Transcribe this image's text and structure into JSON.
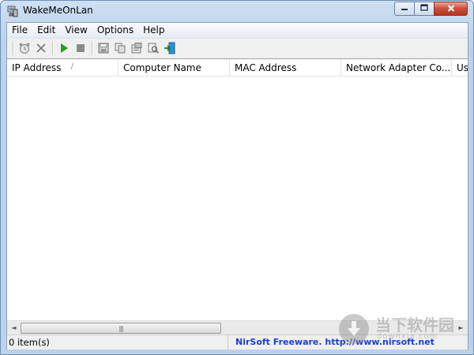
{
  "window": {
    "title": "WakeMeOnLan",
    "app_icon": "network-computer-icon",
    "caption_buttons": {
      "minimize": "minimize-icon",
      "maximize": "maximize-icon",
      "close": "close-icon"
    }
  },
  "menu": {
    "items": [
      {
        "label": "File"
      },
      {
        "label": "Edit"
      },
      {
        "label": "View"
      },
      {
        "label": "Options"
      },
      {
        "label": "Help"
      }
    ]
  },
  "toolbar": {
    "buttons": [
      {
        "icon": "alarm-clock-icon"
      },
      {
        "icon": "delete-x-icon"
      },
      {
        "icon": "play-start-icon"
      },
      {
        "icon": "stop-icon"
      },
      {
        "icon": "save-disk-icon"
      },
      {
        "icon": "copy-icon"
      },
      {
        "icon": "properties-icon"
      },
      {
        "icon": "find-icon"
      },
      {
        "icon": "exit-door-icon"
      }
    ]
  },
  "list": {
    "columns": [
      {
        "label": "IP Address",
        "sorted": true
      },
      {
        "label": "Computer Name"
      },
      {
        "label": "MAC Address"
      },
      {
        "label": "Network Adapter Co..."
      },
      {
        "label": "Us"
      }
    ],
    "rows": []
  },
  "scrollbar": {
    "left_arrow": "◄",
    "right_arrow": "►",
    "grip": "|||"
  },
  "status": {
    "items_count": "0 item(s)",
    "credit": "NirSoft Freeware.  http://www.nirsoft.net"
  },
  "watermark": {
    "title": "当下软件园",
    "subtitle": "downxia.com"
  },
  "colors": {
    "title_gradient_top": "#cfe0f3",
    "close_button": "#c7503c",
    "link_blue": "#1a3fd6",
    "play_green": "#1fa21f"
  }
}
